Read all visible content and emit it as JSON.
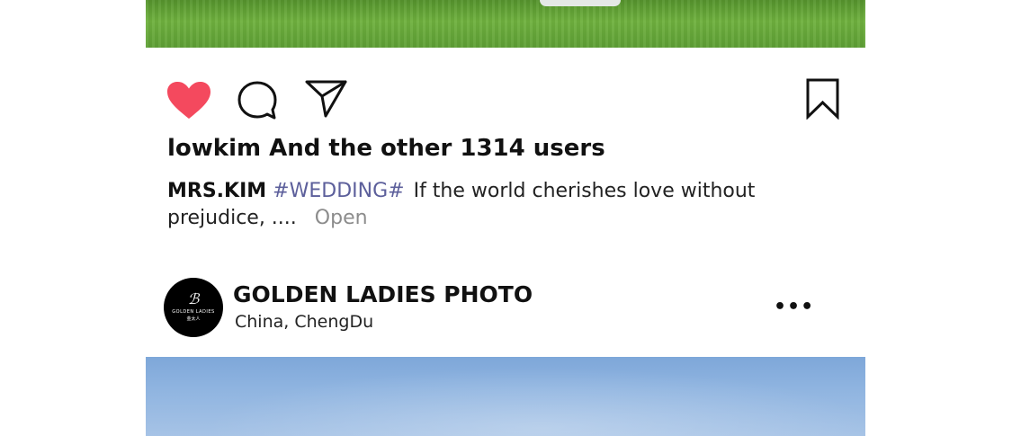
{
  "post": {
    "likes_text": "lowkim And the other 1314 users",
    "caption": {
      "author": "MRS.KIM",
      "hashtag": "#WEDDING#",
      "text": "If the world cherishes love without prejudice, ....",
      "open_label": "Open"
    }
  },
  "next_post": {
    "avatar": {
      "mark": "ℬ",
      "brand": "GOLDEN LADIES",
      "brand_cn": "金太人"
    },
    "account_name": "GOLDEN LADIES PHOTO",
    "location": "China,  ChengDu",
    "more_label": "•••"
  },
  "icons": {
    "like": "heart-icon",
    "comment": "comment-icon",
    "share": "send-icon",
    "save": "bookmark-icon"
  },
  "colors": {
    "like_active": "#f4495e",
    "hashtag": "#5c5f9b",
    "open_link": "#8c8c8c"
  }
}
